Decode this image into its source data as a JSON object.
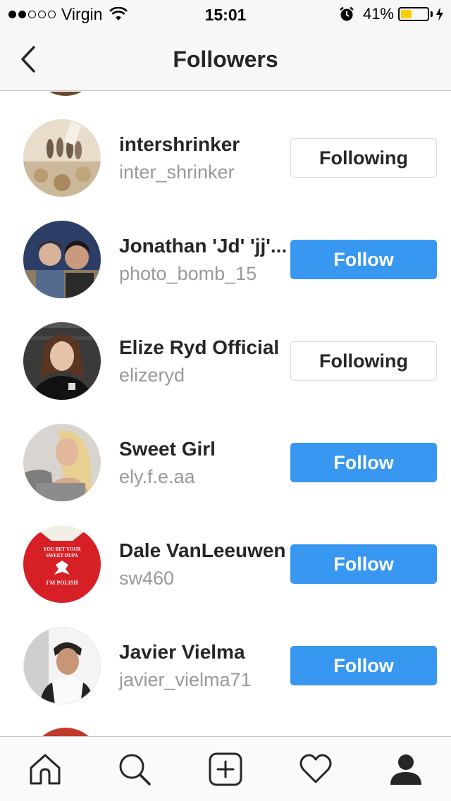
{
  "status_bar": {
    "carrier": "Virgin",
    "time": "15:01",
    "battery": "41%"
  },
  "nav": {
    "title": "Followers",
    "back_icon": "chevron-left-icon"
  },
  "followers": [
    {
      "name": "intershrinker",
      "username": "inter_shrinker",
      "button": "Following",
      "state": "following"
    },
    {
      "name": "Jonathan 'Jd' 'jj'...",
      "username": "photo_bomb_15",
      "button": "Follow",
      "state": "follow"
    },
    {
      "name": "Elize Ryd Official",
      "username": "elizeryd",
      "button": "Following",
      "state": "following"
    },
    {
      "name": "Sweet Girl",
      "username": "ely.f.e.aa",
      "button": "Follow",
      "state": "follow"
    },
    {
      "name": "Dale VanLeeuwen",
      "username": "sw460",
      "button": "Follow",
      "state": "follow"
    },
    {
      "name": "Javier Vielma",
      "username": "javier_vielma71",
      "button": "Follow",
      "state": "follow"
    }
  ],
  "tab_bar": {
    "tabs": [
      "home-icon",
      "search-icon",
      "add-post-icon",
      "heart-icon",
      "profile-icon"
    ]
  },
  "colors": {
    "follow_blue": "#3897f0",
    "text_primary": "#262626",
    "text_secondary": "#999999",
    "battery_yellow": "#ffcc00"
  }
}
